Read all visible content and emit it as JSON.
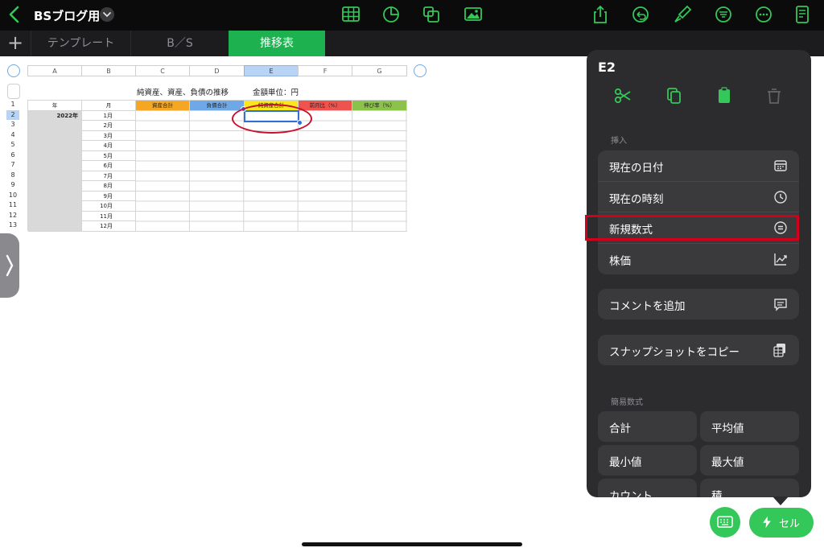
{
  "app": {
    "doc_title": "BSブログ用",
    "tabs": [
      {
        "label": "テンプレート",
        "active": false
      },
      {
        "label": "B／S",
        "active": false
      },
      {
        "label": "推移表",
        "active": true
      }
    ],
    "toolbar_icons": [
      "table-icon",
      "chart-icon",
      "shape-icon",
      "media-icon",
      "share-icon",
      "undo-icon",
      "format-brush-icon",
      "organize-icon",
      "more-icon",
      "view-icon"
    ]
  },
  "sheet": {
    "title": "純資産、資産、負債の推移",
    "unit": "金額単位：円",
    "column_letters": [
      "A",
      "B",
      "C",
      "D",
      "E",
      "F",
      "G"
    ],
    "selected_column": "E",
    "row_numbers": [
      "1",
      "2",
      "3",
      "4",
      "5",
      "6",
      "7",
      "8",
      "9",
      "10",
      "11",
      "12",
      "13"
    ],
    "selected_row": "2",
    "header_row": [
      "年",
      "月",
      "資産合計",
      "負債合計",
      "純資産合計",
      "前月比（%）",
      "伸び率（%）"
    ],
    "year": "2022年",
    "months": [
      "1月",
      "2月",
      "3月",
      "4月",
      "5月",
      "6月",
      "7月",
      "8月",
      "9月",
      "10月",
      "11月",
      "12月"
    ]
  },
  "panel": {
    "cell_ref": "E2",
    "actions": [
      "scissors-icon",
      "copy-icon",
      "paste-icon",
      "trash-icon"
    ],
    "insert_section": "挿入",
    "insert_items": [
      {
        "label": "現在の日付",
        "icon": "calendar-icon"
      },
      {
        "label": "現在の時刻",
        "icon": "clock-icon"
      },
      {
        "label": "新規数式",
        "icon": "equals-circle-icon"
      },
      {
        "label": "株価",
        "icon": "stock-chart-icon"
      }
    ],
    "comment_label": "コメントを追加",
    "snapshot_label": "スナップショットをコピー",
    "quick_section": "簡易数式",
    "quick_items": [
      "合計",
      "平均値",
      "最小値",
      "最大値",
      "カウント",
      "積"
    ]
  },
  "bottom": {
    "cell_button_label": "セル"
  },
  "colors": {
    "accent_green": "#1db150",
    "header_orange": "#f5a623",
    "header_blue": "#6fa8e6",
    "header_yellow": "#f8e71c",
    "header_red": "#ef5350",
    "header_green": "#8bc34a",
    "highlight_red": "#d0021b"
  }
}
